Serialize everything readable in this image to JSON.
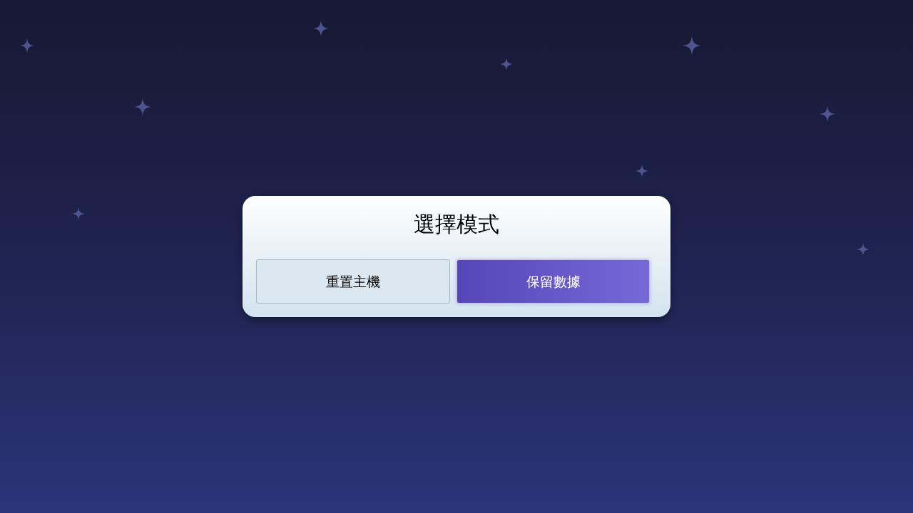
{
  "dialog": {
    "title": "選擇模式",
    "buttons": [
      {
        "label": "重置主機",
        "selected": false
      },
      {
        "label": "保留數據",
        "selected": true
      }
    ]
  }
}
